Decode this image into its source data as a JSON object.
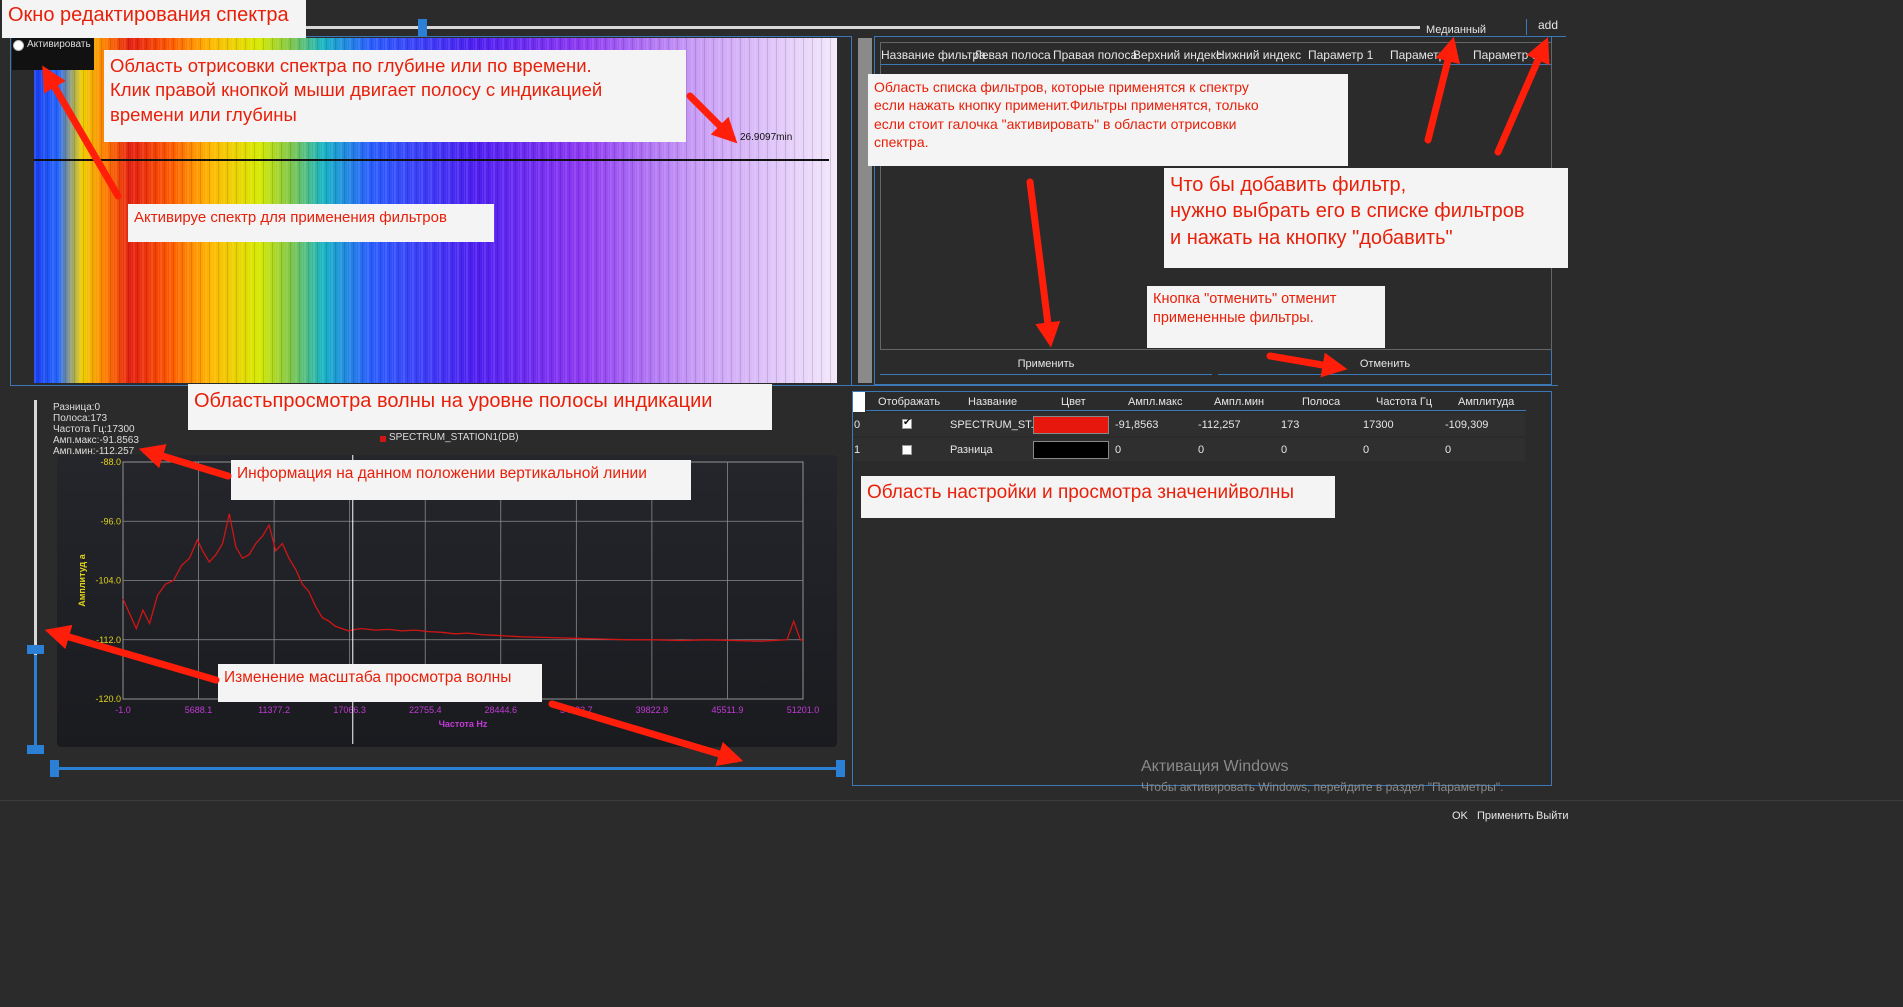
{
  "window": {
    "title": "Окно редактирования спектра",
    "median_label": "Медианный",
    "add_label": "add"
  },
  "spectrum": {
    "activate_label": "Активировать",
    "time_marker": "26.9097min"
  },
  "filters": {
    "headers": [
      "Название фильтра",
      "Левая полоса",
      "Правая полоса",
      "Верхний индекс",
      "Нижний индекс",
      "Параметр 1",
      "Параметр 2",
      "Параметр 3"
    ],
    "apply_label": "Применить",
    "cancel_label": "Отменить"
  },
  "wave_info": {
    "lines": [
      "Разница:0",
      "Полоса:173",
      "Частота Гц:17300",
      "Амп.макс:-91.8563",
      "Амп.мин:-112.257"
    ]
  },
  "chart_data": {
    "type": "line",
    "legend": "SPECTRUM_STATION1(DB)",
    "xlabel": "Частота Hz",
    "ylabel": "Амплитуд а",
    "x_ticks": [
      "-1.0",
      "5688.1",
      "11377.2",
      "17066.3",
      "22755.4",
      "28444.6",
      "34133.7",
      "39822.8",
      "45511.9",
      "51201.0"
    ],
    "y_ticks": [
      "-88.0",
      "-96.0",
      "-104.0",
      "-112.0",
      "-120.0"
    ],
    "xlim": [
      -1,
      51201
    ],
    "ylim": [
      -120,
      -88
    ],
    "cursor_x": 17300,
    "series": [
      {
        "name": "SPECTRUM_STATION1(DB)",
        "color": "#d01515",
        "x": [
          -1,
          500,
          1000,
          1500,
          2000,
          2600,
          3200,
          3800,
          4400,
          5000,
          5600,
          6000,
          6500,
          7000,
          7500,
          8000,
          8500,
          9000,
          9500,
          10000,
          10500,
          11000,
          11500,
          12000,
          12500,
          13000,
          13500,
          14000,
          14500,
          15000,
          15500,
          16000,
          16500,
          17000,
          17500,
          18000,
          19000,
          20000,
          21000,
          22000,
          23000,
          24000,
          25000,
          26000,
          27000,
          28000,
          30000,
          32000,
          34000,
          36000,
          38000,
          40000,
          42000,
          44000,
          46000,
          48000,
          50000,
          50500,
          51000,
          51201
        ],
        "y": [
          -106.5,
          -108.5,
          -110.5,
          -108,
          -109.8,
          -106,
          -104.5,
          -104,
          -102,
          -101,
          -98.5,
          -100,
          -101.5,
          -100.5,
          -99,
          -95,
          -99.5,
          -101,
          -100.5,
          -99,
          -98,
          -96.5,
          -100,
          -99,
          -101,
          -102.5,
          -104.5,
          -105.5,
          -107.5,
          -109,
          -109.5,
          -110.2,
          -110.5,
          -110.8,
          -110.6,
          -110.5,
          -110.7,
          -110.6,
          -110.8,
          -110.7,
          -110.9,
          -111,
          -111.2,
          -111.1,
          -111.3,
          -111.4,
          -111.6,
          -111.7,
          -111.8,
          -111.9,
          -112,
          -112,
          -112.1,
          -112,
          -112.1,
          -112.2,
          -112,
          -109.5,
          -112,
          -112.1
        ]
      }
    ]
  },
  "waves_table": {
    "headers": [
      "Отображать",
      "Название",
      "Цвет",
      "Ампл.макс",
      "Ампл.мин",
      "Полоса",
      "Частота Гц",
      "Амплитуда"
    ],
    "rows": [
      {
        "index": "0",
        "checked": true,
        "name": "SPECTRUM_ST...",
        "color": "#e8170d",
        "max": "-91,8563",
        "min": "-112,257",
        "band": "173",
        "freq": "17300",
        "amp": "-109,309"
      },
      {
        "index": "1",
        "checked": true,
        "name": "Разница",
        "color": "#000000",
        "max": "0",
        "min": "0",
        "band": "0",
        "freq": "0",
        "amp": "0"
      }
    ]
  },
  "callouts": {
    "spectrum_area": "Область отрисовки спектра по глубине или по времени.\nКлик правой кнопкой мыши двигает полосу с индикацией\nвремени или глубины",
    "activate": "Активируе спектр для применения фильтров",
    "filter_list": "Область списка фильтров, которые применятся к спектру\nесли нажать кнопку применит.Фильтры применятся, только\nесли стоит галочка \"активировать\" в области отрисовки\nспектра.",
    "add_filter": "Что бы добавить фильтр,\nнужно выбрать его в списке фильтров\nи нажать на кнопку \"добавить\"",
    "cancel": "Кнопка \"отменить\" отменит\nпримененные фильтры.",
    "wave_view": "Областьпросмотра волны на уровне полосы индикации",
    "info": "Информация на данном положении вертикальной линии",
    "scale": "Изменение масштаба просмотра волны",
    "settings": "Область настройки и просмотра значенийволны"
  },
  "watermark": {
    "title": "Активация Windows",
    "subtitle": "Чтобы активировать Windows, перейдите в раздел \"Параметры\"."
  },
  "footer": {
    "ok": "OK",
    "apply": "Применить",
    "exit": "Выйти"
  }
}
